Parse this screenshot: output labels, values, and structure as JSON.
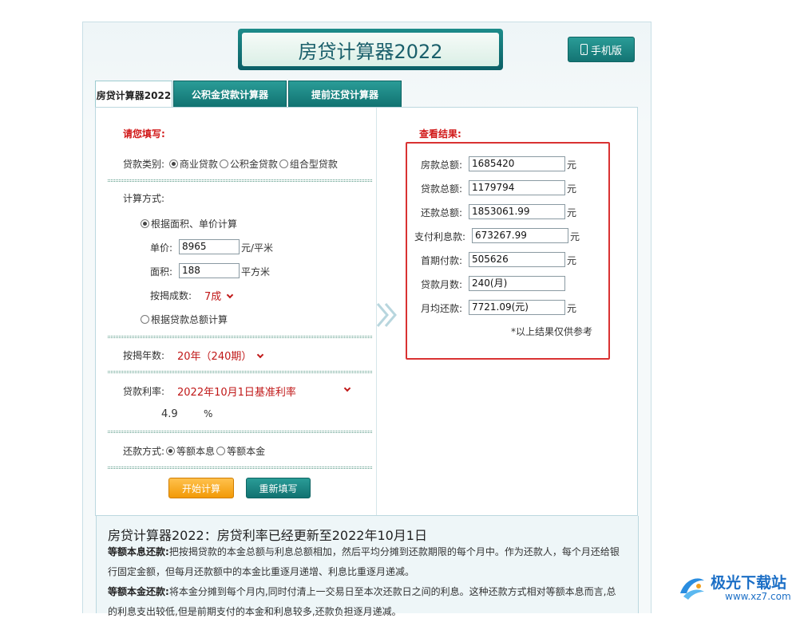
{
  "header": {
    "title": "房贷计算器2022",
    "mobile_label": "手机版"
  },
  "tabs": [
    {
      "label": "房贷计算器2022",
      "active": true
    },
    {
      "label": "公积金贷款计算器",
      "active": false
    },
    {
      "label": "提前还贷计算器",
      "active": false
    }
  ],
  "form": {
    "heading": "请您填写:",
    "loan_type_label": "贷款类别:",
    "loan_types": [
      "商业贷款",
      "公积金贷款",
      "组合型贷款"
    ],
    "calc_method_label": "计算方式:",
    "method_area": "根据面积、单价计算",
    "price_label": "单价:",
    "price_value": "8965",
    "price_unit": "元/平米",
    "area_label": "面积:",
    "area_value": "188",
    "area_unit": "平方米",
    "ratio_label": "按揭成数:",
    "ratio_value": "7成",
    "method_total": "根据贷款总额计算",
    "years_label": "按揭年数:",
    "years_value": "20年（240期）",
    "rate_label": "贷款利率:",
    "rate_value": "2022年10月1日基准利率",
    "rate_number": "4.9",
    "rate_unit": "%",
    "repay_label": "还款方式:",
    "repay_options": [
      "等额本息",
      "等额本金"
    ],
    "start_button": "开始计算",
    "reset_button": "重新填写"
  },
  "results": {
    "heading": "查看结果:",
    "rows": [
      {
        "label": "房款总额:",
        "value": "1685420",
        "unit": "元"
      },
      {
        "label": "贷款总额:",
        "value": "1179794",
        "unit": "元"
      },
      {
        "label": "还款总额:",
        "value": "1853061.99",
        "unit": "元"
      },
      {
        "label": "支付利息款:",
        "value": "673267.99",
        "unit": "元"
      },
      {
        "label": "首期付款:",
        "value": "505626",
        "unit": "元"
      },
      {
        "label": "贷款月数:",
        "value": "240(月)",
        "unit": ""
      },
      {
        "label": "月均还款:",
        "value": "7721.09(元)",
        "unit": "元"
      }
    ],
    "note": "*以上结果仅供参考"
  },
  "info": {
    "title": "房贷计算器2022：房贷利率已经更新至2022年10月1日",
    "p1_bold": "等额本息还款:",
    "p1_text": "把按揭贷款的本金总额与利息总额相加，然后平均分摊到还款期限的每个月中。作为还款人，每个月还给银",
    "p1_cont": "行固定金额，但每月还款额中的本金比重逐月递增、利息比重逐月递减。",
    "p2_bold": "等额本金还款:",
    "p2_text": "将本金分摊到每个月内,同时付清上一交易日至本次还款日之间的利息。这种还款方式相对等额本息而言,总",
    "p2_cont": "的利息支出较低,但是前期支付的本金和利息较多,还款负担逐月递减。"
  },
  "watermark": {
    "name": "极光下载站",
    "url": "www.xz7.com"
  },
  "colors": {
    "teal": "#137473",
    "red": "#d11818",
    "orange": "#f29a06",
    "watermark_blue": "#1c6fc6"
  }
}
